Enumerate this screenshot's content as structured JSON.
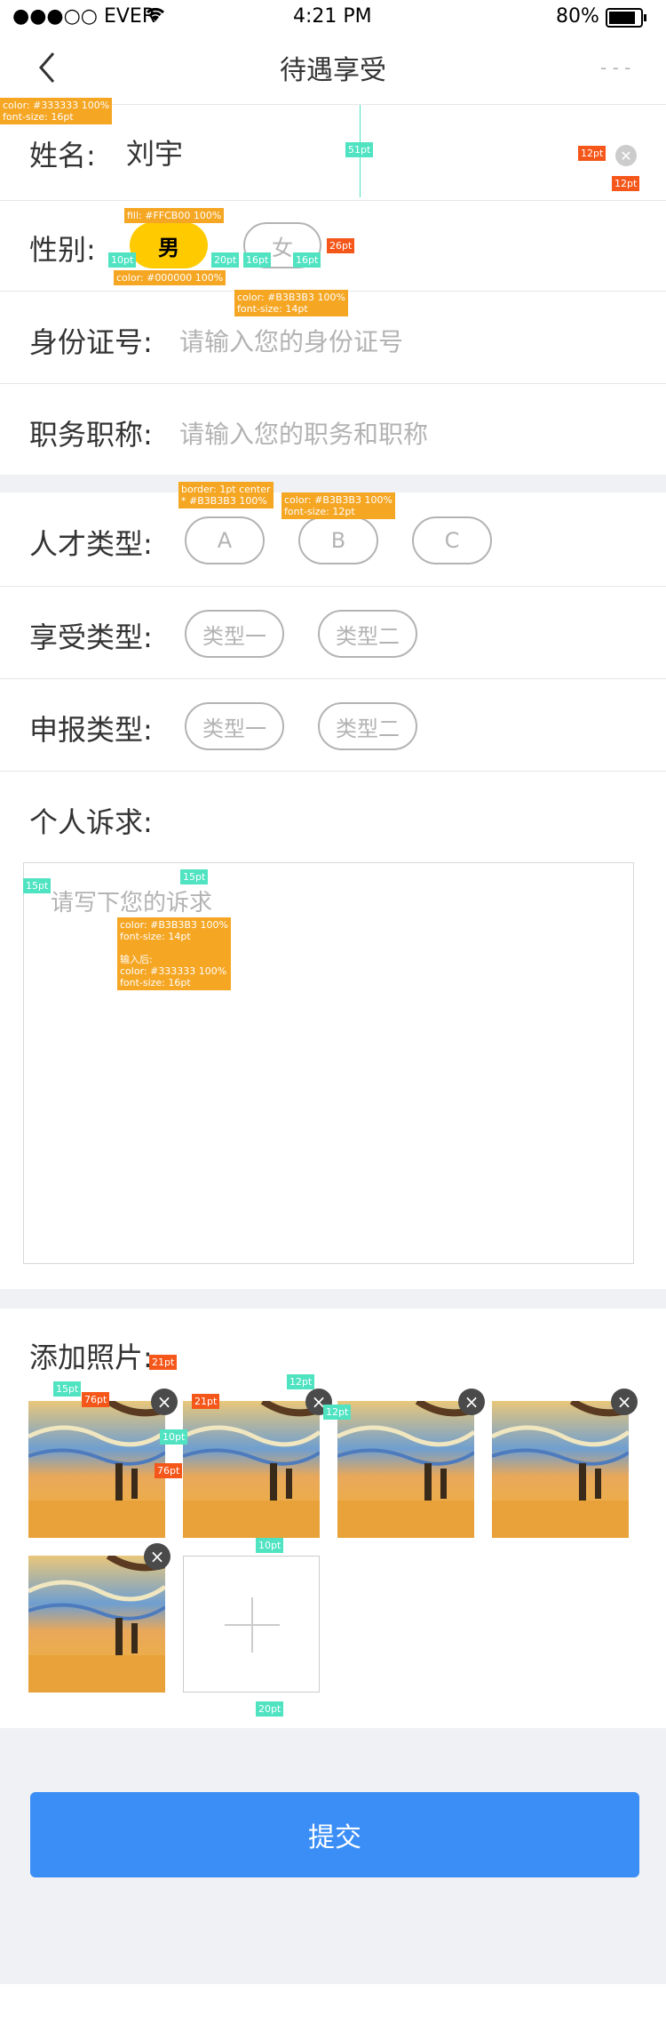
{
  "status_bar": {
    "carrier": "●●●○○ EVER",
    "time": "4:21 PM",
    "battery": "80%"
  },
  "nav": {
    "title": "待遇享受",
    "more": "- - -"
  },
  "form": {
    "name_label": "姓名:",
    "name_value": "刘宇",
    "gender_label": "性别:",
    "gender_male": "男",
    "gender_female": "女",
    "id_label": "身份证号:",
    "id_placeholder": "请输入您的身份证号",
    "title_label": "职务职称:",
    "title_placeholder": "请输入您的职务和职称",
    "talent_label": "人才类型:",
    "talent_options": [
      "A",
      "B",
      "C"
    ],
    "enjoy_label": "享受类型:",
    "enjoy_options": [
      "类型一",
      "类型二"
    ],
    "report_label": "申报类型:",
    "report_options": [
      "类型一",
      "类型二"
    ],
    "appeal_label": "个人诉求:",
    "appeal_placeholder": "请写下您的诉求",
    "photo_label": "添加照片:"
  },
  "submit_label": "提交",
  "annotations": {
    "name_style": "color: #333333 100%\nfont-size: 16pt",
    "row_height": "51pt",
    "clear_size": "12pt",
    "clear_margin": "12pt",
    "gender_fill": "fill: #FFCB00 100%",
    "gender_color": "color: #000000 100%",
    "gender_pad": "10pt",
    "gender_gap": "20pt",
    "gender_w1": "16pt",
    "gender_w2": "16pt",
    "gender_h": "26pt",
    "placeholder_style": "color: #B3B3B3 100%\nfont-size: 14pt",
    "pill_border": "border: 1pt center\n* #B3B3B3 100%",
    "pill_text": "color: #B3B3B3 100%\nfont-size: 12pt",
    "textarea_left": "15pt",
    "textarea_top": "15pt",
    "textarea_style": "color: #B3B3B3 100%\nfont-size: 14pt\n\n输入后:\ncolor: #333333 100%\nfont-size: 16pt",
    "photo_top": "15pt",
    "photo_w": "76pt",
    "del_size": "21pt",
    "del_size2": "21pt",
    "photo_gap": "10pt",
    "photo_h": "76pt",
    "del_pos1": "12pt",
    "del_pos2": "12pt",
    "row_gap": "10pt",
    "bottom_gap": "20pt"
  }
}
